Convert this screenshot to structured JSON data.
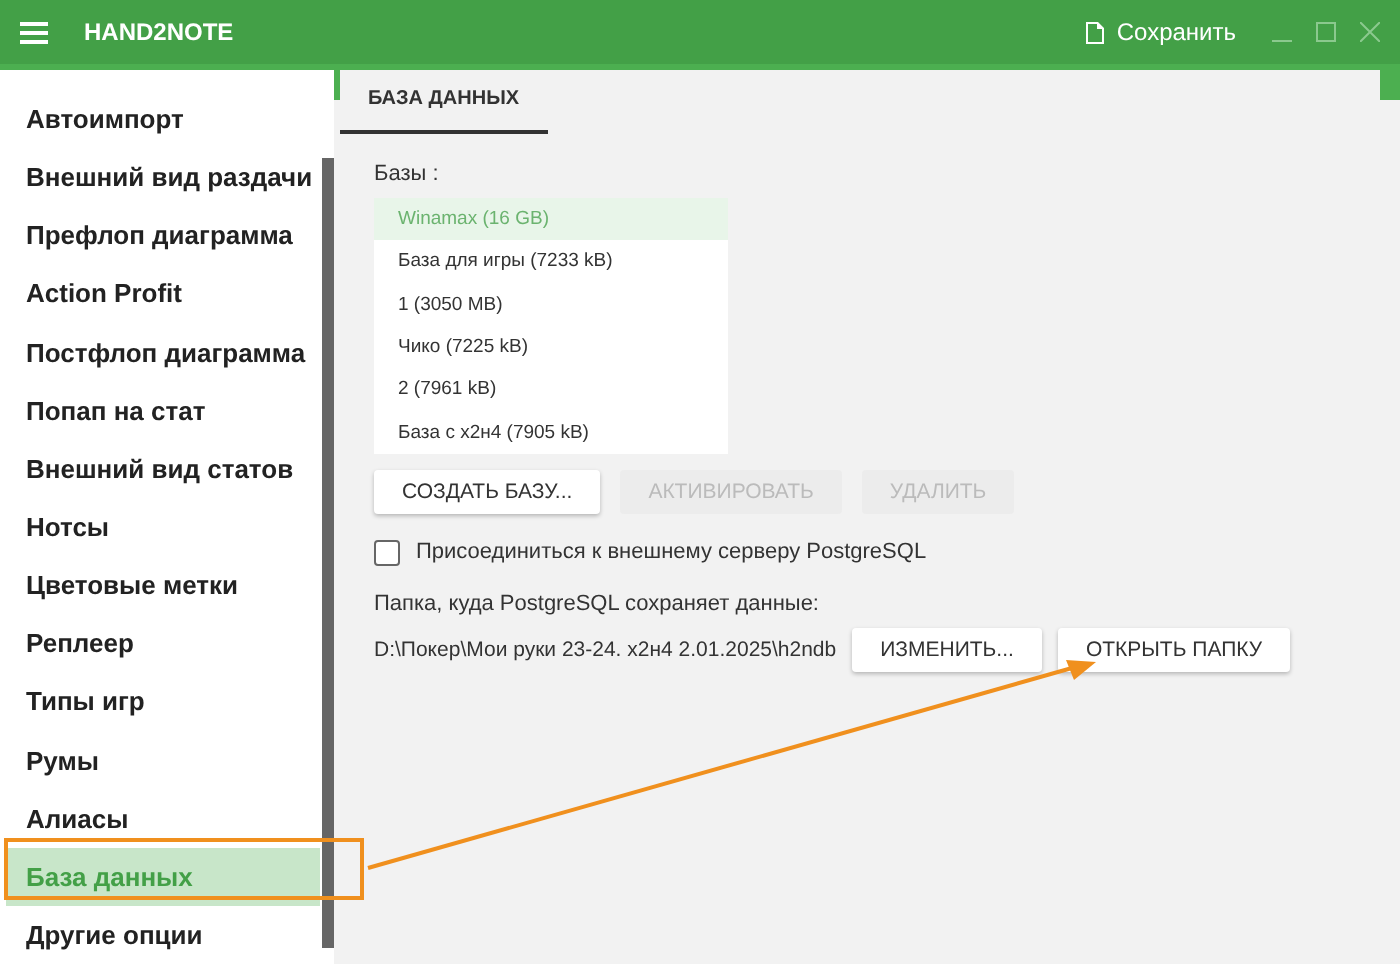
{
  "app": {
    "title": "HAND2NOTE",
    "save": "Сохранить"
  },
  "sidebar": {
    "items": [
      {
        "label": "Автоимпорт",
        "selected": false
      },
      {
        "label": "Внешний вид раздачи",
        "selected": false
      },
      {
        "label": "Префлоп диаграмма",
        "selected": false
      },
      {
        "label": "Action Profit",
        "selected": false
      },
      {
        "label": "Постфлоп диаграмма",
        "selected": false
      },
      {
        "label": "Попап на стат",
        "selected": false
      },
      {
        "label": "Внешний вид статов",
        "selected": false
      },
      {
        "label": "Нотсы",
        "selected": false
      },
      {
        "label": "Цветовые метки",
        "selected": false
      },
      {
        "label": "Реплеер",
        "selected": false
      },
      {
        "label": "Типы игр",
        "selected": false
      },
      {
        "label": "Румы",
        "selected": false
      },
      {
        "label": "Алиасы",
        "selected": false
      },
      {
        "label": "База данных",
        "selected": true,
        "highlighted": true
      },
      {
        "label": "Другие опции",
        "selected": false
      }
    ]
  },
  "tabs": [
    {
      "label": "БАЗА ДАННЫХ",
      "selected": true
    }
  ],
  "databases": {
    "label": "Базы :",
    "items": [
      {
        "label": "Winamax (16 GB)",
        "selected": true
      },
      {
        "label": "База для игры (7233 kB)",
        "selected": false
      },
      {
        "label": "1 (3050 MB)",
        "selected": false
      },
      {
        "label": "Чико (7225 kB)",
        "selected": false
      },
      {
        "label": "2 (7961 kB)",
        "selected": false
      },
      {
        "label": "База с х2н4 (7905 kB)",
        "selected": false
      }
    ]
  },
  "db_buttons": [
    {
      "label": "СОЗДАТЬ БАЗУ...",
      "disabled": false
    },
    {
      "label": "АКТИВИРОВАТЬ",
      "disabled": true
    },
    {
      "label": "УДАЛИТЬ",
      "disabled": true
    }
  ],
  "external_server": {
    "label": "Присоединиться к внешнему серверу PostgreSQL",
    "checked": false
  },
  "folder": {
    "label": "Папка, куда PostgreSQL сохраняет данные:",
    "path": "D:\\Покер\\Мои руки 23-24. х2н4 2.01.2025\\h2ndb",
    "buttons": [
      {
        "label": "ИЗМЕНИТЬ...",
        "disabled": false
      },
      {
        "label": "ОТКРЫТЬ ПАПКУ",
        "disabled": false
      }
    ]
  }
}
